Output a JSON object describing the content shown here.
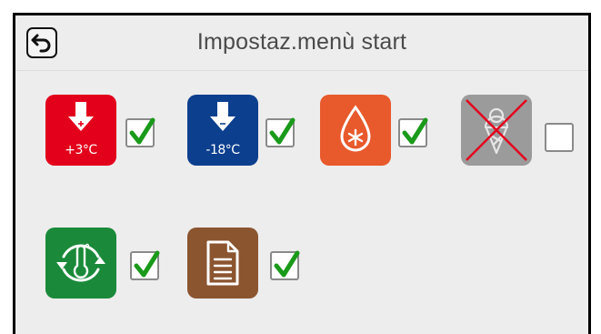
{
  "header": {
    "title": "Impostaz.menù start",
    "back_icon": "back-arrow-icon"
  },
  "items": [
    {
      "id": "fast-cooling",
      "icon": "arrow-down-icon",
      "label": "+3°C",
      "color": "#e3001b",
      "checked": true,
      "enabled": true
    },
    {
      "id": "fast-freezing",
      "icon": "arrow-down-icon",
      "label": "-18°C",
      "color": "#0c3f8e",
      "checked": true,
      "enabled": true
    },
    {
      "id": "thawing",
      "icon": "drop-snowflake-icon",
      "label": "",
      "color": "#e8592b",
      "checked": true,
      "enabled": true
    },
    {
      "id": "ice-cream",
      "icon": "ice-cream-crossed-icon",
      "label": "",
      "color": "#9b9b9b",
      "checked": false,
      "enabled": false
    },
    {
      "id": "conservation",
      "icon": "thermometer-cycle-icon",
      "label": "",
      "color": "#1a8a3a",
      "checked": true,
      "enabled": true
    },
    {
      "id": "recipes",
      "icon": "document-icon",
      "label": "",
      "color": "#8b5530",
      "checked": true,
      "enabled": true
    }
  ],
  "colors": {
    "check": "#1a9a1a",
    "frame": "#000000",
    "background": "#ededed"
  }
}
